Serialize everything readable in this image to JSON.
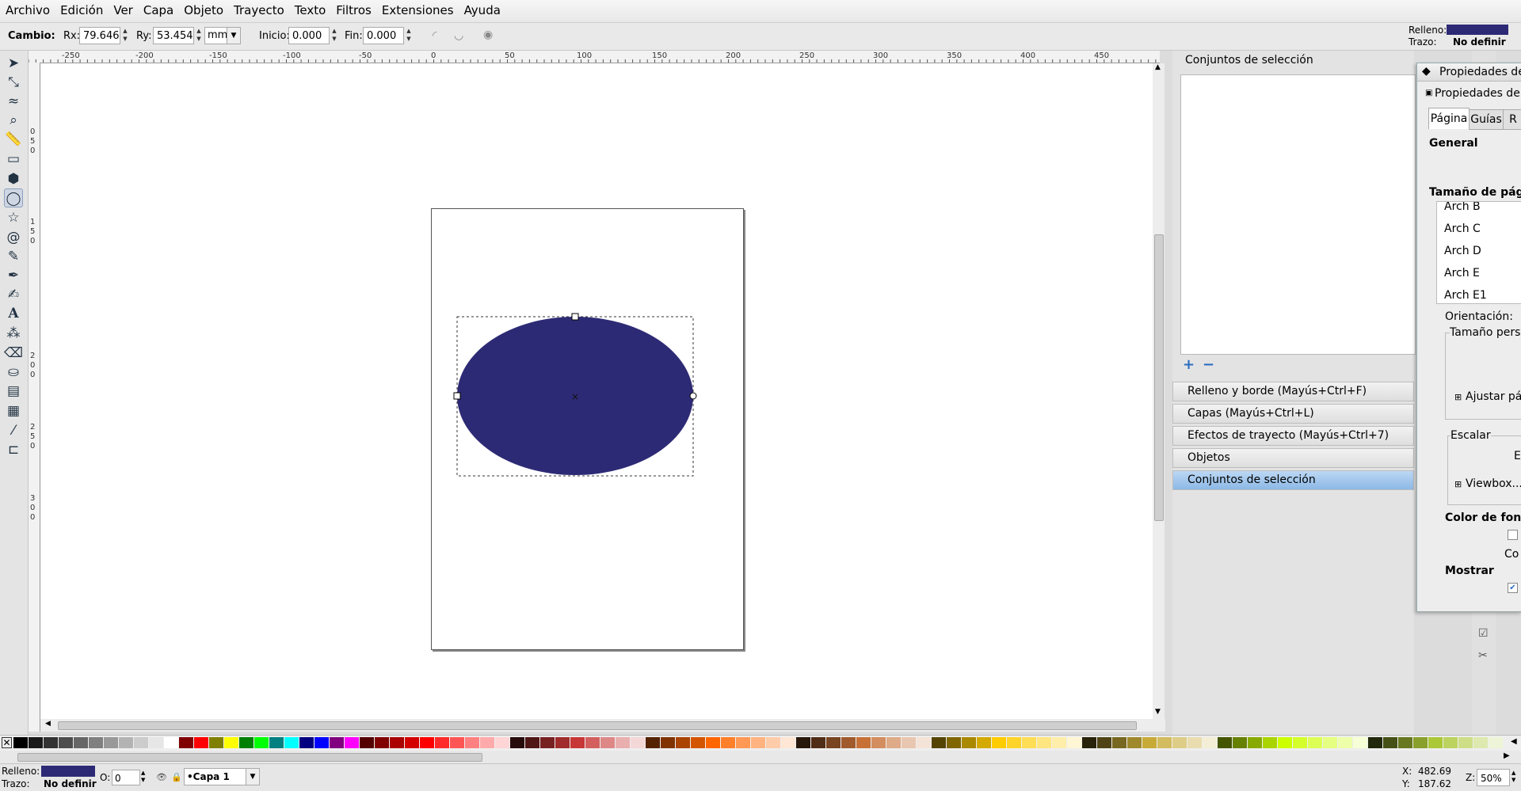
{
  "menu": [
    "Archivo",
    "Edición",
    "Ver",
    "Capa",
    "Objeto",
    "Trayecto",
    "Texto",
    "Filtros",
    "Extensiones",
    "Ayuda"
  ],
  "controls": {
    "title": "Cambio:",
    "rx_label": "Rx:",
    "rx_value": "79.646",
    "ry_label": "Ry:",
    "ry_value": "53.454",
    "unit": "mm",
    "start_label": "Inicio:",
    "start_value": "0.000",
    "end_label": "Fin:",
    "end_value": "0.000"
  },
  "style_indicator": {
    "fill_label": "Relleno:",
    "fill_color": "#2d2a75",
    "stroke_label": "Trazo:",
    "stroke_value": "No definir"
  },
  "ruler_labels": [
    "-250",
    "-200",
    "-150",
    "-100",
    "-50",
    "0",
    "50",
    "100",
    "150",
    "200",
    "250",
    "300",
    "350",
    "400",
    "450"
  ],
  "vruler_labels": [
    "0",
    "5",
    "0",
    "1",
    "5",
    "0",
    "2",
    "0",
    "0",
    "2",
    "5",
    "0",
    "3",
    "0",
    "0"
  ],
  "canvas": {
    "ellipse_color": "#2d2a75",
    "page_color": "#ffffff"
  },
  "dock": {
    "selection_sets_title": "Conjuntos de selección",
    "panels": [
      "Relleno y borde (Mayús+Ctrl+F)",
      "Capas (Mayús+Ctrl+L)",
      "Efectos de trayecto (Mayús+Ctrl+7)",
      "Objetos",
      "Conjuntos de selección"
    ]
  },
  "dialog": {
    "title": "Propiedades de",
    "subtitle": "Propiedades del",
    "tabs": [
      "Página",
      "Guías",
      "R"
    ],
    "general": "General",
    "page_size": "Tamaño de pági",
    "sizes": [
      "Arch B",
      "Arch C",
      "Arch D",
      "Arch E",
      "Arch E1"
    ],
    "orientation": "Orientación:",
    "custom_size": "Tamaño perso",
    "fit_page": "Ajustar pág",
    "scale": "Escalar",
    "scale_e": "E",
    "viewbox": "Viewbox...",
    "bg_color": "Color de fond",
    "bg_co": "Co",
    "show": "Mostrar"
  },
  "status": {
    "fill_label": "Relleno:",
    "fill_color": "#2d2a75",
    "stroke_label": "Trazo:",
    "stroke_value": "No definir",
    "opacity_label": "O:",
    "opacity_value": "0",
    "layer": "•Capa 1",
    "x_label": "X:",
    "x_value": "482.69",
    "y_label": "Y:",
    "y_value": "187.62",
    "zoom_label": "Z:",
    "zoom_value": "50%"
  },
  "palette_colors": [
    "#000000",
    "#1a1a1a",
    "#333333",
    "#4d4d4d",
    "#666666",
    "#808080",
    "#999999",
    "#b3b3b3",
    "#cccccc",
    "#e6e6e6",
    "#ffffff",
    "#800000",
    "#ff0000",
    "#808000",
    "#ffff00",
    "#008000",
    "#00ff00",
    "#008080",
    "#00ffff",
    "#000080",
    "#0000ff",
    "#800080",
    "#ff00ff",
    "#550000",
    "#800000",
    "#aa0000",
    "#d40000",
    "#ff0000",
    "#ff2a2a",
    "#ff5555",
    "#ff8080",
    "#ffaaaa",
    "#ffd5d5",
    "#280b0b",
    "#501616",
    "#782121",
    "#a02c2c",
    "#c83737",
    "#d35f5f",
    "#de8787",
    "#e9afaf",
    "#f4d7d7",
    "#552200",
    "#803300",
    "#aa4400",
    "#d45500",
    "#ff6600",
    "#ff7f2a",
    "#ff9955",
    "#ffb380",
    "#ffccaa",
    "#ffe6d5",
    "#28170b",
    "#502d16",
    "#784421",
    "#a05a2c",
    "#c87137",
    "#d38d5f",
    "#deaa87",
    "#e9c6af",
    "#f4e3d7",
    "#554400",
    "#806600",
    "#aa8800",
    "#d4aa00",
    "#ffcc00",
    "#ffd42a",
    "#ffdd55",
    "#ffe680",
    "#ffeeaa",
    "#fff6d5",
    "#28220b",
    "#504416",
    "#786721",
    "#a0892c",
    "#c8ab37",
    "#d3bc5f",
    "#decd87",
    "#e9ddaf",
    "#f4eed7",
    "#445500",
    "#668000",
    "#88aa00",
    "#aad400",
    "#ccff00",
    "#d4ff2a",
    "#ddff55",
    "#e5ff80",
    "#eeffaa",
    "#f6ffd5",
    "#22280b",
    "#445016",
    "#677821",
    "#89a02c",
    "#abc837",
    "#bcd35f",
    "#cdde87",
    "#dde9af",
    "#eef4d7"
  ]
}
